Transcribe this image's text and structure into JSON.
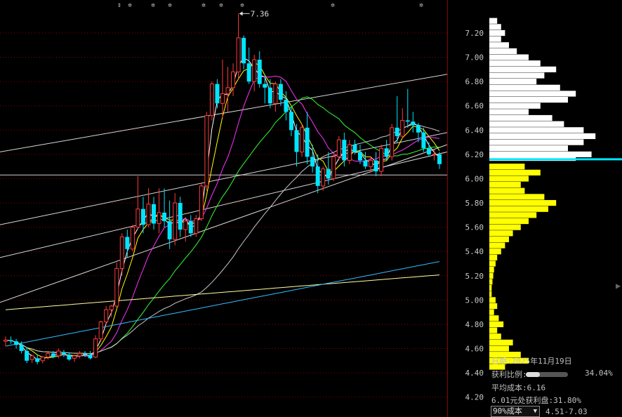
{
  "chart_data": {
    "type": "candlestick",
    "high_label": "7.36",
    "price_axis": {
      "ticks": [
        "7.20",
        "7.00",
        "6.80",
        "6.60",
        "6.40",
        "6.20",
        "6.00",
        "5.80",
        "5.60",
        "5.40",
        "5.20",
        "5.00",
        "4.80",
        "4.60",
        "4.40",
        "4.20"
      ],
      "ylim": [
        4.13,
        7.4
      ]
    },
    "current_price": 6.12,
    "reference_price": 6.03,
    "candles": [
      [
        4.66,
        4.7,
        4.62,
        4.67
      ],
      [
        4.67,
        4.7,
        4.64,
        4.66
      ],
      [
        4.66,
        4.68,
        4.6,
        4.63
      ],
      [
        4.63,
        4.66,
        4.56,
        4.58
      ],
      [
        4.58,
        4.61,
        4.48,
        4.5
      ],
      [
        4.51,
        4.55,
        4.48,
        4.54
      ],
      [
        4.52,
        4.55,
        4.47,
        4.49
      ],
      [
        4.5,
        4.54,
        4.48,
        4.53
      ],
      [
        4.53,
        4.57,
        4.51,
        4.56
      ],
      [
        4.56,
        4.58,
        4.52,
        4.53
      ],
      [
        4.54,
        4.6,
        4.52,
        4.58
      ],
      [
        4.57,
        4.59,
        4.53,
        4.55
      ],
      [
        4.55,
        4.57,
        4.5,
        4.51
      ],
      [
        4.52,
        4.55,
        4.49,
        4.54
      ],
      [
        4.54,
        4.58,
        4.52,
        4.56
      ],
      [
        4.56,
        4.58,
        4.53,
        4.55
      ],
      [
        4.55,
        4.58,
        4.51,
        4.52
      ],
      [
        4.53,
        4.71,
        4.52,
        4.68
      ],
      [
        4.68,
        4.83,
        4.66,
        4.82
      ],
      [
        4.82,
        4.95,
        4.8,
        4.92
      ],
      [
        4.92,
        4.96,
        4.86,
        4.95
      ],
      [
        4.95,
        5.31,
        4.94,
        5.26
      ],
      [
        5.26,
        5.55,
        5.2,
        5.52
      ],
      [
        5.52,
        5.58,
        5.35,
        5.42
      ],
      [
        5.42,
        5.62,
        5.4,
        5.6
      ],
      [
        5.6,
        6.02,
        5.58,
        5.75
      ],
      [
        5.75,
        5.85,
        5.55,
        5.62
      ],
      [
        5.62,
        5.92,
        5.6,
        5.79
      ],
      [
        5.79,
        5.85,
        5.58,
        5.63
      ],
      [
        5.63,
        5.92,
        5.55,
        5.72
      ],
      [
        5.72,
        5.92,
        5.6,
        5.65
      ],
      [
        5.65,
        5.82,
        5.42,
        5.5
      ],
      [
        5.5,
        5.88,
        5.45,
        5.8
      ],
      [
        5.8,
        5.85,
        5.52,
        5.58
      ],
      [
        5.58,
        5.68,
        5.48,
        5.65
      ],
      [
        5.65,
        5.7,
        5.52,
        5.55
      ],
      [
        5.55,
        5.7,
        5.52,
        5.67
      ],
      [
        5.67,
        5.96,
        5.65,
        5.94
      ],
      [
        5.94,
        6.55,
        5.9,
        6.52
      ],
      [
        6.52,
        6.8,
        6.48,
        6.78
      ],
      [
        6.78,
        6.82,
        6.58,
        6.62
      ],
      [
        6.62,
        6.98,
        6.5,
        6.7
      ],
      [
        6.7,
        6.92,
        6.55,
        6.75
      ],
      [
        6.75,
        6.95,
        6.68,
        6.88
      ],
      [
        6.88,
        7.36,
        6.82,
        7.16
      ],
      [
        7.16,
        7.18,
        6.9,
        6.95
      ],
      [
        6.95,
        7.08,
        6.78,
        6.8
      ],
      [
        6.8,
        7.02,
        6.72,
        6.98
      ],
      [
        6.98,
        7.05,
        6.75,
        6.78
      ],
      [
        6.78,
        6.85,
        6.62,
        6.75
      ],
      [
        6.75,
        6.82,
        6.58,
        6.62
      ],
      [
        6.62,
        6.8,
        6.55,
        6.78
      ],
      [
        6.78,
        6.82,
        6.6,
        6.65
      ],
      [
        6.65,
        6.72,
        6.48,
        6.55
      ],
      [
        6.55,
        6.6,
        6.35,
        6.4
      ],
      [
        6.4,
        6.45,
        6.1,
        6.22
      ],
      [
        6.22,
        6.45,
        6.18,
        6.42
      ],
      [
        6.42,
        6.55,
        6.12,
        6.18
      ],
      [
        6.18,
        6.28,
        6.05,
        6.1
      ],
      [
        6.1,
        6.2,
        5.88,
        5.94
      ],
      [
        5.94,
        6.1,
        5.9,
        6.08
      ],
      [
        6.08,
        6.22,
        5.95,
        6.0
      ],
      [
        6.0,
        6.2,
        5.98,
        6.18
      ],
      [
        6.18,
        6.35,
        6.15,
        6.32
      ],
      [
        6.32,
        6.38,
        6.1,
        6.15
      ],
      [
        6.15,
        6.32,
        6.12,
        6.28
      ],
      [
        6.28,
        6.32,
        6.2,
        6.22
      ],
      [
        6.22,
        6.28,
        6.12,
        6.15
      ],
      [
        6.15,
        6.22,
        6.08,
        6.1
      ],
      [
        6.1,
        6.18,
        6.05,
        6.15
      ],
      [
        6.15,
        6.22,
        6.02,
        6.06
      ],
      [
        6.06,
        6.28,
        6.02,
        6.25
      ],
      [
        6.25,
        6.32,
        6.15,
        6.18
      ],
      [
        6.18,
        6.45,
        6.15,
        6.42
      ],
      [
        6.42,
        6.68,
        6.3,
        6.35
      ],
      [
        6.35,
        6.58,
        6.33,
        6.48
      ],
      [
        6.48,
        6.74,
        6.42,
        6.47
      ],
      [
        6.47,
        6.55,
        6.38,
        6.44
      ],
      [
        6.44,
        6.46,
        6.3,
        6.38
      ],
      [
        6.38,
        6.42,
        6.22,
        6.25
      ],
      [
        6.25,
        6.3,
        6.18,
        6.2
      ],
      [
        6.2,
        6.24,
        6.15,
        6.2
      ],
      [
        6.2,
        6.22,
        6.08,
        6.12
      ]
    ],
    "markers": [
      "⇕",
      "✲",
      "✲",
      "✲",
      "✲",
      "✲",
      "✲",
      "✲",
      "✲"
    ],
    "cost_distribution": {
      "current_price": 6.16,
      "profit_bins": [
        [
          7.3,
          1.0
        ],
        [
          7.25,
          1.5
        ],
        [
          7.2,
          2.0
        ],
        [
          7.15,
          1.5
        ],
        [
          7.1,
          2.5
        ],
        [
          7.05,
          3.5
        ],
        [
          7.0,
          5.0
        ],
        [
          6.95,
          6.5
        ],
        [
          6.9,
          8.5
        ],
        [
          6.85,
          7.0
        ],
        [
          6.8,
          6.0
        ],
        [
          6.75,
          9.0
        ],
        [
          6.7,
          11.0
        ],
        [
          6.65,
          10.0
        ],
        [
          6.6,
          6.5
        ],
        [
          6.55,
          5.0
        ],
        [
          6.5,
          8.0
        ],
        [
          6.45,
          9.5
        ],
        [
          6.4,
          12.0
        ],
        [
          6.35,
          13.5
        ],
        [
          6.3,
          12.0
        ],
        [
          6.25,
          10.0
        ],
        [
          6.2,
          13.0
        ],
        [
          6.17,
          11.0
        ]
      ],
      "loss_bins": [
        [
          6.1,
          4.5
        ],
        [
          6.05,
          6.5
        ],
        [
          6.0,
          5.0
        ],
        [
          5.95,
          4.0
        ],
        [
          5.9,
          4.5
        ],
        [
          5.85,
          7.0
        ],
        [
          5.8,
          8.5
        ],
        [
          5.75,
          7.5
        ],
        [
          5.7,
          6.0
        ],
        [
          5.65,
          5.0
        ],
        [
          5.6,
          4.0
        ],
        [
          5.55,
          3.0
        ],
        [
          5.5,
          2.5
        ],
        [
          5.45,
          2.0
        ],
        [
          5.4,
          1.5
        ],
        [
          5.35,
          1.0
        ],
        [
          5.3,
          0.8
        ],
        [
          5.25,
          0.6
        ],
        [
          5.2,
          0.5
        ],
        [
          5.15,
          0.4
        ],
        [
          5.1,
          0.3
        ],
        [
          5.05,
          0.3
        ],
        [
          5.0,
          0.8
        ],
        [
          4.95,
          1.0
        ],
        [
          4.9,
          0.6
        ],
        [
          4.85,
          1.2
        ],
        [
          4.8,
          1.8
        ],
        [
          4.75,
          1.0
        ],
        [
          4.7,
          1.5
        ],
        [
          4.65,
          3.0
        ],
        [
          4.6,
          2.5
        ],
        [
          4.55,
          4.0
        ],
        [
          4.5,
          5.0
        ],
        [
          4.45,
          2.0
        ]
      ]
    }
  },
  "info_panel": {
    "date_label": "日期:",
    "date_value": "2025年11月19日",
    "profit_ratio_label": "获利比例:",
    "profit_ratio_value": "34.04%",
    "profit_ratio_fraction": 0.3404,
    "avg_cost_label": "平均成本:",
    "avg_cost_value": "6.16",
    "profit_at_text": "6.01元处获利盘:",
    "profit_at_value": "31.80%",
    "cost_select_value": "90%成本",
    "cost_range_value": "4.51-7.03"
  },
  "colors": {
    "up": "#ff3b3b",
    "down": "#00e5ff",
    "ma1": "#ffffff",
    "ma2": "#ffff00",
    "ma3": "#ff33ff",
    "ma4": "#33ff33",
    "ma5": "#c8c8c8",
    "ma6": "#ffffa0",
    "ma7": "#33bbff",
    "profit_fill": "#ffffff",
    "loss_fill": "#ffff00",
    "current_line": "#00e5ff",
    "axis_text": "#c8c8c8",
    "grid": "#8b0000"
  }
}
